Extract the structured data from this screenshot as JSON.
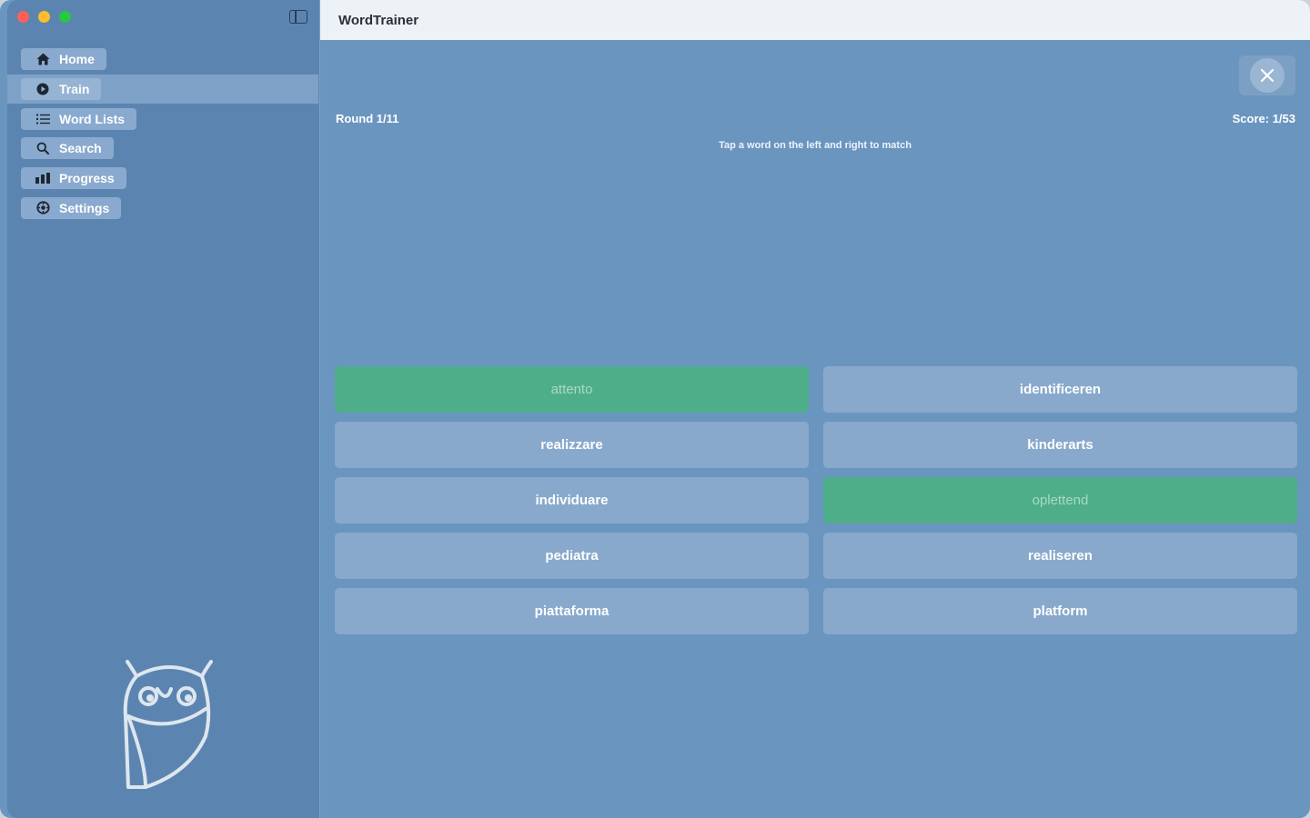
{
  "app": {
    "title": "WordTrainer"
  },
  "sidebar": {
    "items": [
      {
        "label": "Home",
        "icon": "home-icon",
        "active": false
      },
      {
        "label": "Train",
        "icon": "play-icon",
        "active": true
      },
      {
        "label": "Word Lists",
        "icon": "list-icon",
        "active": false
      },
      {
        "label": "Search",
        "icon": "search-icon",
        "active": false
      },
      {
        "label": "Progress",
        "icon": "bar-chart-icon",
        "active": false
      },
      {
        "label": "Settings",
        "icon": "gear-icon",
        "active": false
      }
    ],
    "logo": "owl-logo"
  },
  "game": {
    "round": "Round 1/11",
    "score": "Score: 1/53",
    "hint": "Tap a word on the left and right to match",
    "left_words": [
      {
        "text": "attento",
        "state": "matched"
      },
      {
        "text": "realizzare",
        "state": "default"
      },
      {
        "text": "individuare",
        "state": "default"
      },
      {
        "text": "pediatra",
        "state": "default"
      },
      {
        "text": "piattaforma",
        "state": "default"
      }
    ],
    "right_words": [
      {
        "text": "identificeren",
        "state": "default"
      },
      {
        "text": "kinderarts",
        "state": "default"
      },
      {
        "text": "oplettend",
        "state": "matched"
      },
      {
        "text": "realiseren",
        "state": "default"
      },
      {
        "text": "platform",
        "state": "default"
      }
    ]
  },
  "colors": {
    "accent_match": "#4fae8a",
    "background": "#6a95bf",
    "sidebar": "#5b85b0"
  }
}
